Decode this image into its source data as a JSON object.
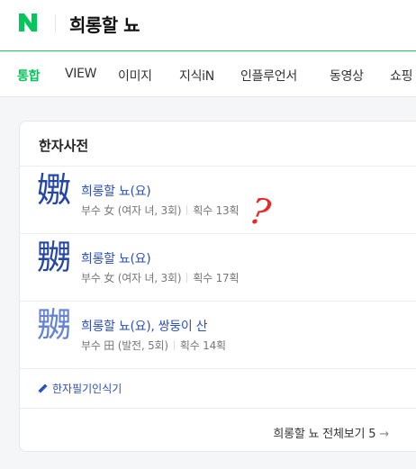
{
  "header": {
    "logo_letter": "N",
    "query": "희롱할 뇨"
  },
  "tabs": [
    {
      "label": "통합"
    },
    {
      "label": "VIEW"
    },
    {
      "label": "이미지"
    },
    {
      "label": "지식iN"
    },
    {
      "label": "인플루언서"
    },
    {
      "label": "동영상"
    },
    {
      "label": "쇼핑"
    }
  ],
  "card": {
    "title": "한자사전",
    "entries": [
      {
        "hanja": "嫐",
        "meaning": "희롱할 뇨(요)",
        "radical": "부수 女 (여자 녀, 3회)",
        "strokes": "획수 13획"
      },
      {
        "hanja": "嬲",
        "meaning": "희롱할 뇨(요)",
        "radical": "부수 女 (여자 녀, 3회)",
        "strokes": "획수 17획"
      },
      {
        "hanja": "嬲",
        "meaning": "희롱할 뇨(요), 쌍둥이 산",
        "radical": "부수 田 (발전, 5회)",
        "strokes": "획수 14획"
      }
    ],
    "annotation": "?",
    "handwriting_link": "한자필기인식기",
    "more_link": "희롱할 뇨 전체보기 5",
    "more_arrow": "→"
  },
  "colors": {
    "brand": "#03c75a",
    "link": "#2d4fc0",
    "hanja": "#2446a8",
    "annotation": "#e52b2b"
  }
}
